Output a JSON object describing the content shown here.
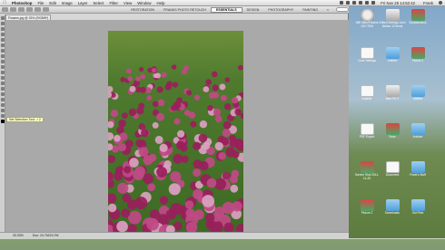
{
  "menubar": {
    "app": "Photoshop",
    "items": [
      "File",
      "Edit",
      "Image",
      "Layer",
      "Select",
      "Filter",
      "View",
      "Window",
      "Help"
    ],
    "clock": "Fri Nov 25  14:52:42",
    "user": "Frank"
  },
  "workspaces": [
    "RESTORATION",
    "FRANKS PHOTO RETOUCH",
    "ESSENTIALS",
    "DESIGN",
    "PHOTOGRAPHY",
    "PAINTING"
  ],
  "workspace_more": "»",
  "document": {
    "tab": "Flowers.jpg @ 33% (RGB/8*)",
    "tooltip": "Set Selection Tool: ✓2",
    "status": "33.33%",
    "doc_size": "Doc: 24.7M/24.7M"
  },
  "desktop": [
    {
      "label": "Wifi Sites/Folders 120 ITEM",
      "type": "hd"
    },
    {
      "label": "Edited Settings Josh Motion 12 items",
      "type": "disk"
    },
    {
      "label": "Scriptaculous",
      "type": "pic"
    },
    {
      "label": "Color Settings",
      "type": "doc"
    },
    {
      "label": "Untitled",
      "type": "folder"
    },
    {
      "label": "Picture 1",
      "type": "pic"
    },
    {
      "label": "Installer",
      "type": "doc"
    },
    {
      "label": "Mac OS X",
      "type": "disk"
    },
    {
      "label": "Utilities",
      "type": "folder"
    },
    {
      "label": "PDF Export",
      "type": "doc"
    },
    {
      "label": "Scan",
      "type": "pic"
    },
    {
      "label": "Archive",
      "type": "folder"
    },
    {
      "label": "Screen Shot 2011-11-25",
      "type": "pic"
    },
    {
      "label": "Document",
      "type": "doc"
    },
    {
      "label": "Frank's Stuff",
      "type": "folder"
    },
    {
      "label": "Picture 2",
      "type": "pic"
    },
    {
      "label": "Downloads",
      "type": "folder"
    },
    {
      "label": "Old Files",
      "type": "folder"
    }
  ],
  "colors": {
    "accent": "#2f6fd6",
    "flowers": "#b0306e"
  }
}
